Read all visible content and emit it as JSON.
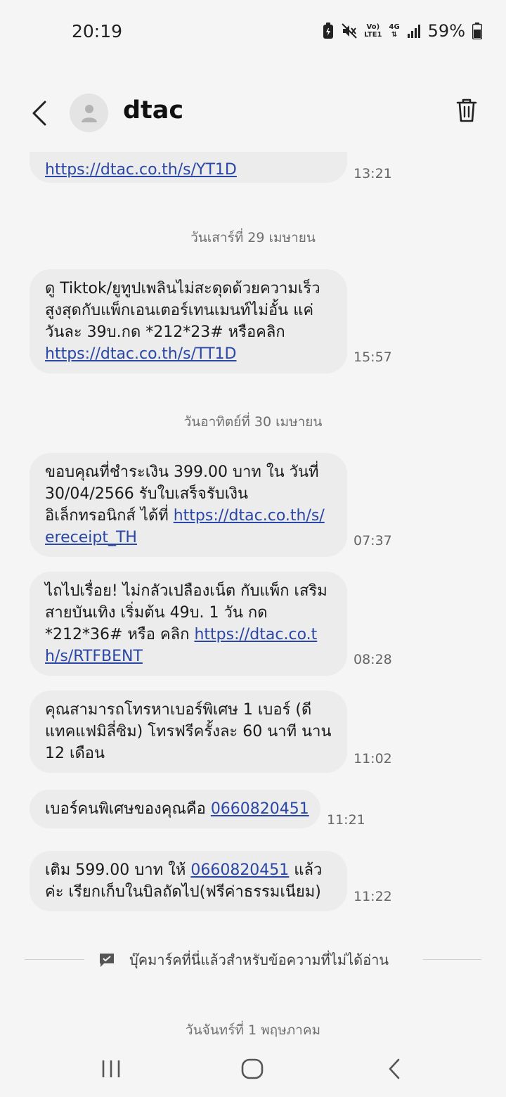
{
  "status_bar": {
    "time": "20:19",
    "volte_top": "Vo)",
    "volte_bottom": "LTE1",
    "network_type": "4G",
    "battery_percent": "59%"
  },
  "header": {
    "contact_name": "dtac"
  },
  "messages": [
    {
      "parts": [
        {
          "text": "https://dtac.co.th/s/YT1D",
          "link": true
        }
      ],
      "time": "13:21"
    },
    {
      "parts": [
        {
          "text": "ดู Tiktok/ยูทูปเพลินไม่สะดุดด้วยความเร็ว สูงสุดกับแพ็กเอนเตอร์เทนเมนท์ไม่อั้น แค่วันละ 39บ.กด *212*23# หรือคลิก ",
          "link": false
        },
        {
          "text": "https://dtac.co.th/s/TT1D",
          "link": true
        }
      ],
      "time": "15:57"
    },
    {
      "parts": [
        {
          "text": "ขอบคุณที่ชำระเงิน 399.00 บาท ใน วันที่ 30/04/2566 รับใบเสร็จรับเงิน อิเล็กทรอนิกส์ ได้ที่ ",
          "link": false
        },
        {
          "text": "https://dtac.co.th/s/ereceipt_TH",
          "link": true
        }
      ],
      "time": "07:37"
    },
    {
      "parts": [
        {
          "text": "ไถไปเรื่อย! ไม่กลัวเปลืองเน็ต กับแพ็ก เสริมสายบันเทิง เริ่มต้น 49บ. 1 วัน กด *212*36# หรือ คลิก ",
          "link": false
        },
        {
          "text": "https://dtac.co.th/s/RTFBENT",
          "link": true
        }
      ],
      "time": "08:28"
    },
    {
      "parts": [
        {
          "text": "คุณสามารถโทรหาเบอร์พิเศษ 1 เบอร์ (ดี แทคแฟมิลี่ซิม) โทรฟรีครั้งละ 60 นาที นาน 12 เดือน",
          "link": false
        }
      ],
      "time": "11:02"
    },
    {
      "parts": [
        {
          "text": "เบอร์คนพิเศษของคุณคือ ",
          "link": false
        },
        {
          "text": "0660820451",
          "link": true
        }
      ],
      "time": "11:21"
    },
    {
      "parts": [
        {
          "text": "เติม 599.00 บาท ให้ ",
          "link": false
        },
        {
          "text": "0660820451",
          "link": true
        },
        {
          "text": " แล้วค่ะ เรียกเก็บในบิลถัดไป(ฟรีค่าธรรมเนียม)",
          "link": false
        }
      ],
      "time": "11:22"
    }
  ],
  "date_separators": {
    "sat": "วันเสาร์ที่ 29 เมษายน",
    "sun": "วันอาทิตย์ที่ 30 เมษายน",
    "mon": "วันจันทร์ที่ 1 พฤษภาคม"
  },
  "bookmark": {
    "label": "บุ๊คมาร์คที่นี่แล้วสำหรับข้อความที่ไม่ได้อ่าน"
  },
  "colors": {
    "background": "#f5f5f5",
    "bubble": "#ececec",
    "link": "#2a47a6"
  }
}
